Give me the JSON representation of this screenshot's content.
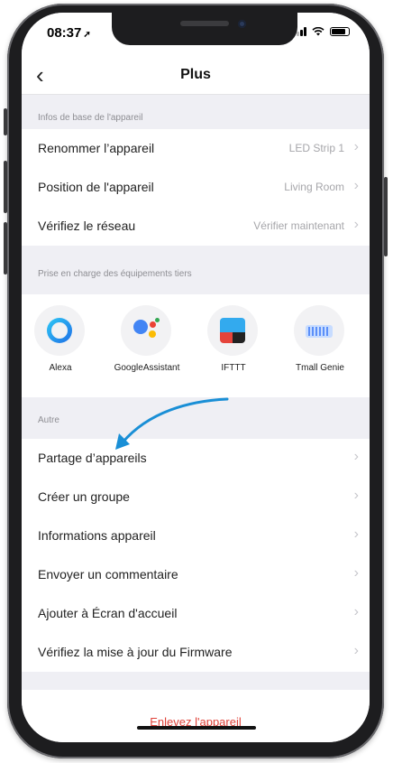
{
  "status_bar": {
    "time": "08:37"
  },
  "nav": {
    "title": "Plus"
  },
  "sections": {
    "basic": {
      "header": "Infos de base de l'appareil",
      "rows": [
        {
          "label": "Renommer l’appareil",
          "value": "LED Strip 1"
        },
        {
          "label": "Position de l'appareil",
          "value": "Living Room"
        },
        {
          "label": "Vérifiez le réseau",
          "value": "Vérifier maintenant"
        }
      ]
    },
    "third_party": {
      "header": "Prise en charge des équipements tiers",
      "items": [
        {
          "label": "Alexa",
          "icon": "alexa-icon"
        },
        {
          "label": "GoogleAssistant",
          "icon": "google-assistant-icon"
        },
        {
          "label": "IFTTT",
          "icon": "ifttt-icon"
        },
        {
          "label": "Tmall Genie",
          "icon": "tmall-genie-icon"
        }
      ]
    },
    "other": {
      "header": "Autre",
      "rows": [
        {
          "label": "Partage d’appareils"
        },
        {
          "label": "Créer un groupe"
        },
        {
          "label": "Informations appareil"
        },
        {
          "label": "Envoyer un commentaire"
        },
        {
          "label": "Ajouter à Écran d'accueil"
        },
        {
          "label": "Vérifiez la mise à jour du Firmware"
        }
      ]
    }
  },
  "footer": {
    "remove_label": "Enlevez l'appareil"
  },
  "colors": {
    "accent_red": "#e0433a",
    "annotation_blue": "#1a8fd6"
  }
}
